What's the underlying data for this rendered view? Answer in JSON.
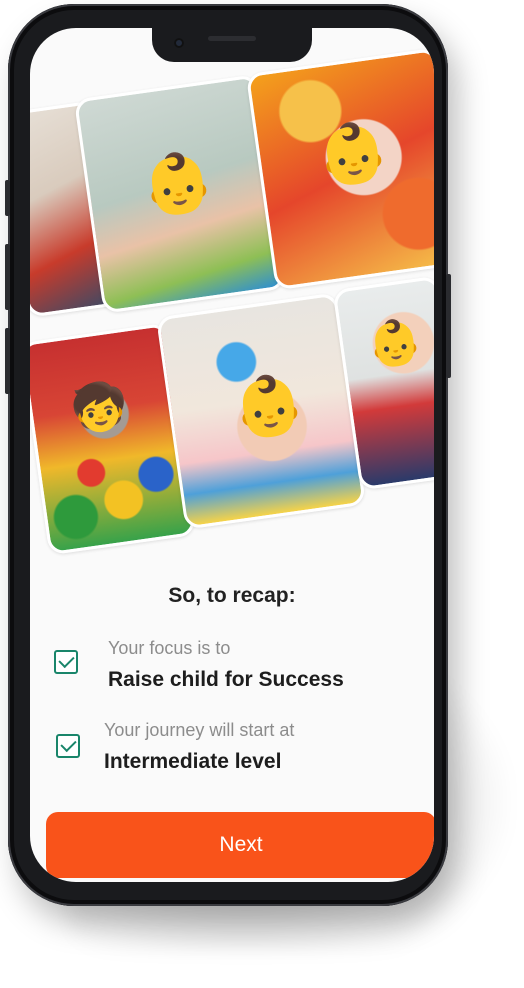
{
  "recap": {
    "title": "So, to recap:",
    "items": [
      {
        "label": "Your focus is to",
        "value": "Raise child for Success",
        "checked": true
      },
      {
        "label": "Your journey will start at",
        "value": "Intermediate level",
        "checked": true
      }
    ]
  },
  "actions": {
    "next_label": "Next"
  },
  "colors": {
    "accent": "#f9531a",
    "check": "#19856a",
    "text": "#1d1d1d",
    "muted": "#8c8c8c"
  },
  "collage": {
    "photos": [
      "baby-with-rattle-photo",
      "baby-portrait-photo",
      "child-in-ball-pit-photo",
      "baby-on-playmat-photo",
      "baby-crawling-photo",
      "baby-with-toy-photo"
    ]
  }
}
